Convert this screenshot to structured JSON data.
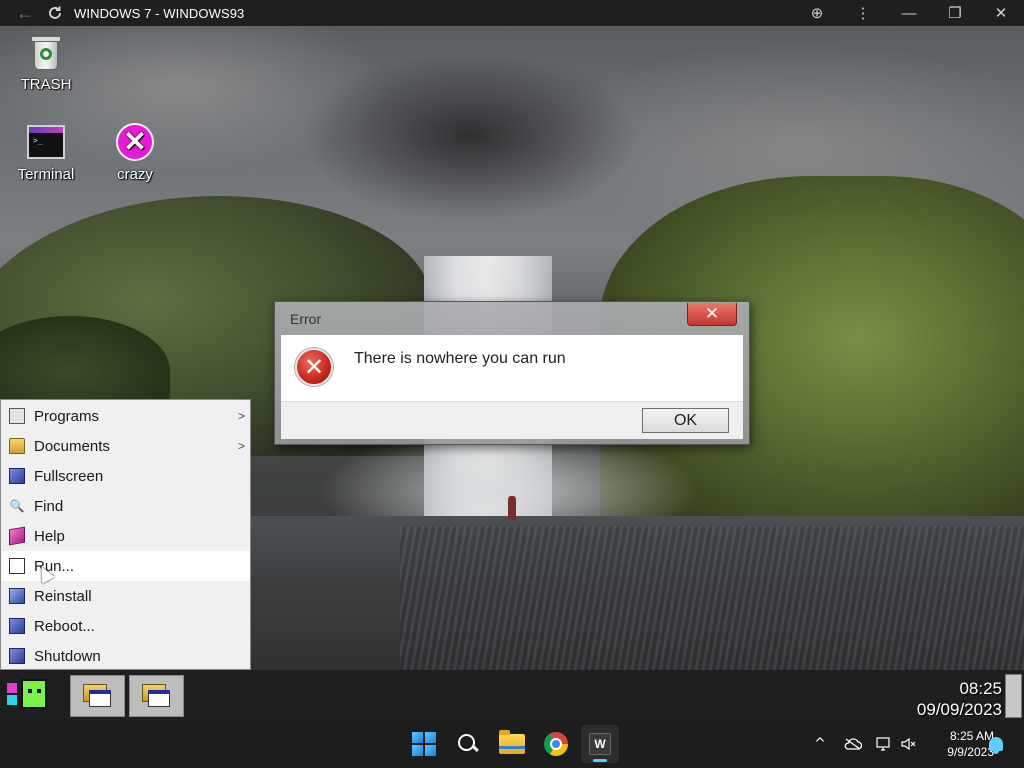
{
  "app_bar": {
    "title": "WINDOWS 7 - WINDOWS93",
    "back_icon": "arrow-left-icon",
    "reload_icon": "reload-icon",
    "zoom_icon": "zoom-icon",
    "menu_icon": "kebab-menu-icon",
    "minimize_icon": "minimize-icon",
    "restore_icon": "restore-icon",
    "close_icon": "close-icon",
    "glyphs": {
      "back": "←",
      "zoom": "⊕",
      "menu": "⋮",
      "minimize": "—",
      "restore": "❐",
      "close": "✕"
    }
  },
  "desktop": {
    "icons": [
      {
        "label": "TRASH",
        "icon": "trash-icon"
      },
      {
        "label": "Terminal",
        "icon": "terminal-icon",
        "prompt": ">_"
      },
      {
        "label": "crazy",
        "icon": "crazy-x-icon",
        "glyph": "✕"
      }
    ]
  },
  "dialog": {
    "title": "Error",
    "close_glyph": "✕",
    "message": "There is nowhere you can run",
    "icon": "error-icon",
    "icon_glyph": "✕",
    "ok_label": "OK"
  },
  "start_menu": {
    "items": [
      {
        "label": "Programs",
        "submenu_arrow": ">",
        "icon": "programs-icon"
      },
      {
        "label": "Documents",
        "submenu_arrow": ">",
        "icon": "documents-icon"
      },
      {
        "label": "Fullscreen",
        "icon": "fullscreen-icon"
      },
      {
        "label": "Find",
        "icon": "find-icon",
        "glyph": "🔍"
      },
      {
        "label": "Help",
        "icon": "help-icon"
      },
      {
        "label": "Run...",
        "icon": "run-icon",
        "highlighted": true
      },
      {
        "label": "Reinstall",
        "icon": "reinstall-icon"
      },
      {
        "label": "Reboot...",
        "icon": "reboot-icon"
      },
      {
        "label": "Shutdown",
        "icon": "shutdown-icon"
      }
    ]
  },
  "w93_taskbar": {
    "clock_time": "08:25",
    "clock_date": "09/09/2023",
    "task_buttons": 2
  },
  "windows_taskbar": {
    "app_tile_letter": "W",
    "tray": {
      "chevron": "^",
      "time": "8:25 AM",
      "date": "9/9/2023"
    }
  },
  "colors": {
    "dialog_close": "#c4382b",
    "error_icon": "#c1231a",
    "start_menu_bg": "#f0f0f0",
    "accent": "#60cdff",
    "crazy_icon": "#e81ad8"
  }
}
